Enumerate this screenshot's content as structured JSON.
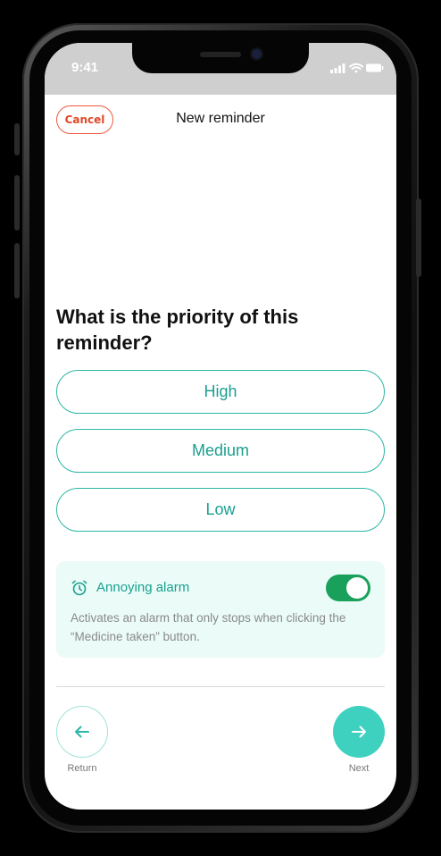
{
  "status_bar": {
    "time": "9:41",
    "icons": [
      "signal-icon",
      "wifi-icon",
      "battery-icon"
    ]
  },
  "header": {
    "cancel_label": "Cancel",
    "title": "New reminder"
  },
  "question": "What is the priority of this reminder?",
  "options": [
    {
      "label": "High"
    },
    {
      "label": "Medium"
    },
    {
      "label": "Low"
    }
  ],
  "alarm": {
    "icon": "alarm-clock-icon",
    "title": "Annoying alarm",
    "enabled": true,
    "description": "Activates an alarm that only stops when clicking the “Medicine taken” button."
  },
  "navigation": {
    "return_label": "Return",
    "next_label": "Next"
  },
  "colors": {
    "accent": "#2bb7a6",
    "accent_text": "#1aa08f",
    "next_button": "#3fd1c0",
    "toggle_on": "#19a05a",
    "cancel": "#e2472a",
    "card_background": "#eafbf8"
  }
}
